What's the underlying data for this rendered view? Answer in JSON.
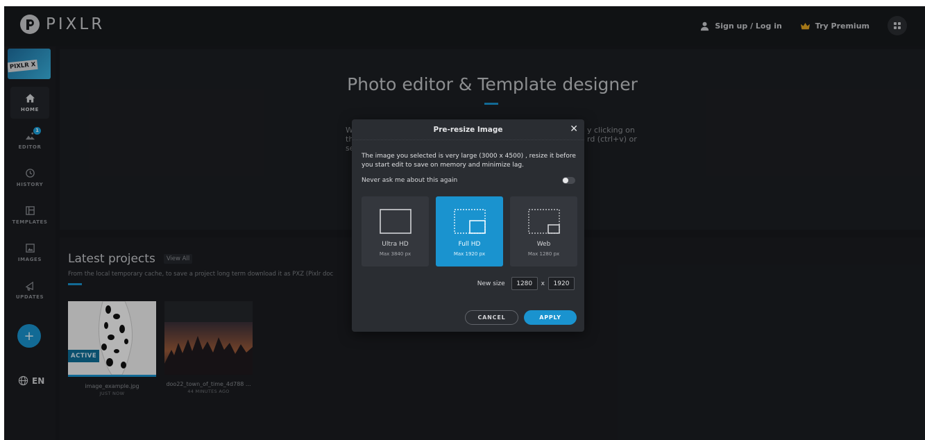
{
  "brand": {
    "name": "PIXLR"
  },
  "header": {
    "signup_label": "Sign up / Log in",
    "premium_label": "Try Premium"
  },
  "sidebar": {
    "pixlrx_label": "PIXLR X",
    "items": [
      {
        "label": "HOME",
        "icon": "home-icon"
      },
      {
        "label": "EDITOR",
        "icon": "image-edit-icon",
        "badge": "1"
      },
      {
        "label": "HISTORY",
        "icon": "history-icon"
      },
      {
        "label": "TEMPLATES",
        "icon": "template-icon"
      },
      {
        "label": "IMAGES",
        "icon": "images-icon"
      },
      {
        "label": "UPDATES",
        "icon": "megaphone-icon"
      }
    ],
    "add_label": "+",
    "language": "EN"
  },
  "hero": {
    "title": "Photo editor & Template designer",
    "text_left": [
      "W",
      "th",
      "se"
    ],
    "text_right": [
      "y clicking on",
      "rd (ctrl+v) or"
    ]
  },
  "projects": {
    "title": "Latest projects",
    "view_all": "View All",
    "subtitle": "From the local temporary cache, to save a project long term download it as PXZ (Pixlr doc",
    "items": [
      {
        "name": "image_example.jpg",
        "time": "JUST NOW",
        "tag": "ACTIVE"
      },
      {
        "name": "doo22_town_of_time_4d788 ...",
        "time": "44 MINUTES AGO"
      }
    ]
  },
  "modal": {
    "title": "Pre-resize Image",
    "close": "✕",
    "message": "The image you selected is very large (3000 x 4500) , resize it before you start edit to save on memory and minimize lag.",
    "never_ask": "Never ask me about this again",
    "options": [
      {
        "name": "Ultra HD",
        "max": "Max 3840 px"
      },
      {
        "name": "Full HD",
        "max": "Max 1920 px"
      },
      {
        "name": "Web",
        "max": "Max 1280 px"
      }
    ],
    "new_size_label": "New size",
    "width": "1280",
    "height": "1920",
    "x_sep": "x",
    "cancel": "CANCEL",
    "apply": "APPLY"
  },
  "colors": {
    "accent": "#1a93cf",
    "background": "#181a1e",
    "modal": "#2a2d32"
  }
}
